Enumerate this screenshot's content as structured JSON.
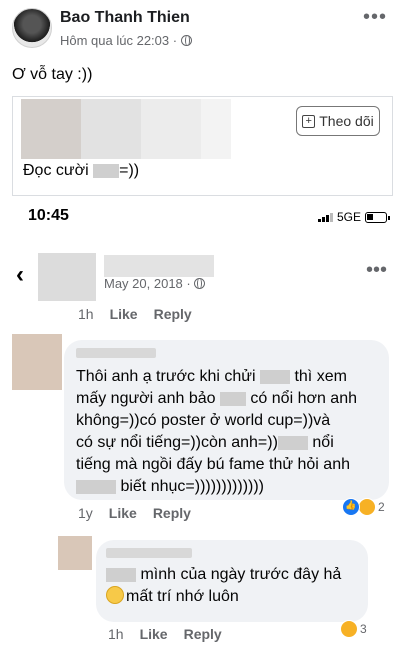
{
  "post": {
    "author": "Bao Thanh Thien",
    "timestamp": "Hôm qua lúc 22:03 ·",
    "more_icon": "more-dots-icon",
    "text": "Ơ vỗ tay :))"
  },
  "embed": {
    "follow_label": "Theo dõi",
    "caption_prefix": "Đọc cười",
    "caption_suffix": "=))"
  },
  "statusbar": {
    "time": "10:45",
    "network": "5GE"
  },
  "thread": {
    "date": "May 20, 2018 ·"
  },
  "comment_actions_top": {
    "time": "1h",
    "like": "Like",
    "reply": "Reply"
  },
  "comment1": {
    "line1_a": "Thôi anh ạ trước khi chửi",
    "line1_b": "thì xem",
    "line2_a": "mấy người anh bảo",
    "line2_b": "có nổi hơn anh",
    "line3": "không=))có poster ở world cup=))và",
    "line4_a": "có sự nổi tiếng=))còn anh=))",
    "line4_b": "nổi",
    "line5": "tiếng mà ngồi đấy bú fame thử hỏi anh",
    "line6": "biết nhục=)))))))))))))",
    "time": "1y",
    "like": "Like",
    "reply": "Reply",
    "reaction_count": "2"
  },
  "comment2": {
    "line1": "mình của ngày trước đây hả",
    "line2": "mất trí nhớ luôn",
    "time": "1h",
    "like": "Like",
    "reply": "Reply",
    "reaction_count": "3"
  },
  "colors": {
    "bubble": "#f0f2f5",
    "muted_text": "#65676b",
    "like_blue": "#1877f2"
  }
}
